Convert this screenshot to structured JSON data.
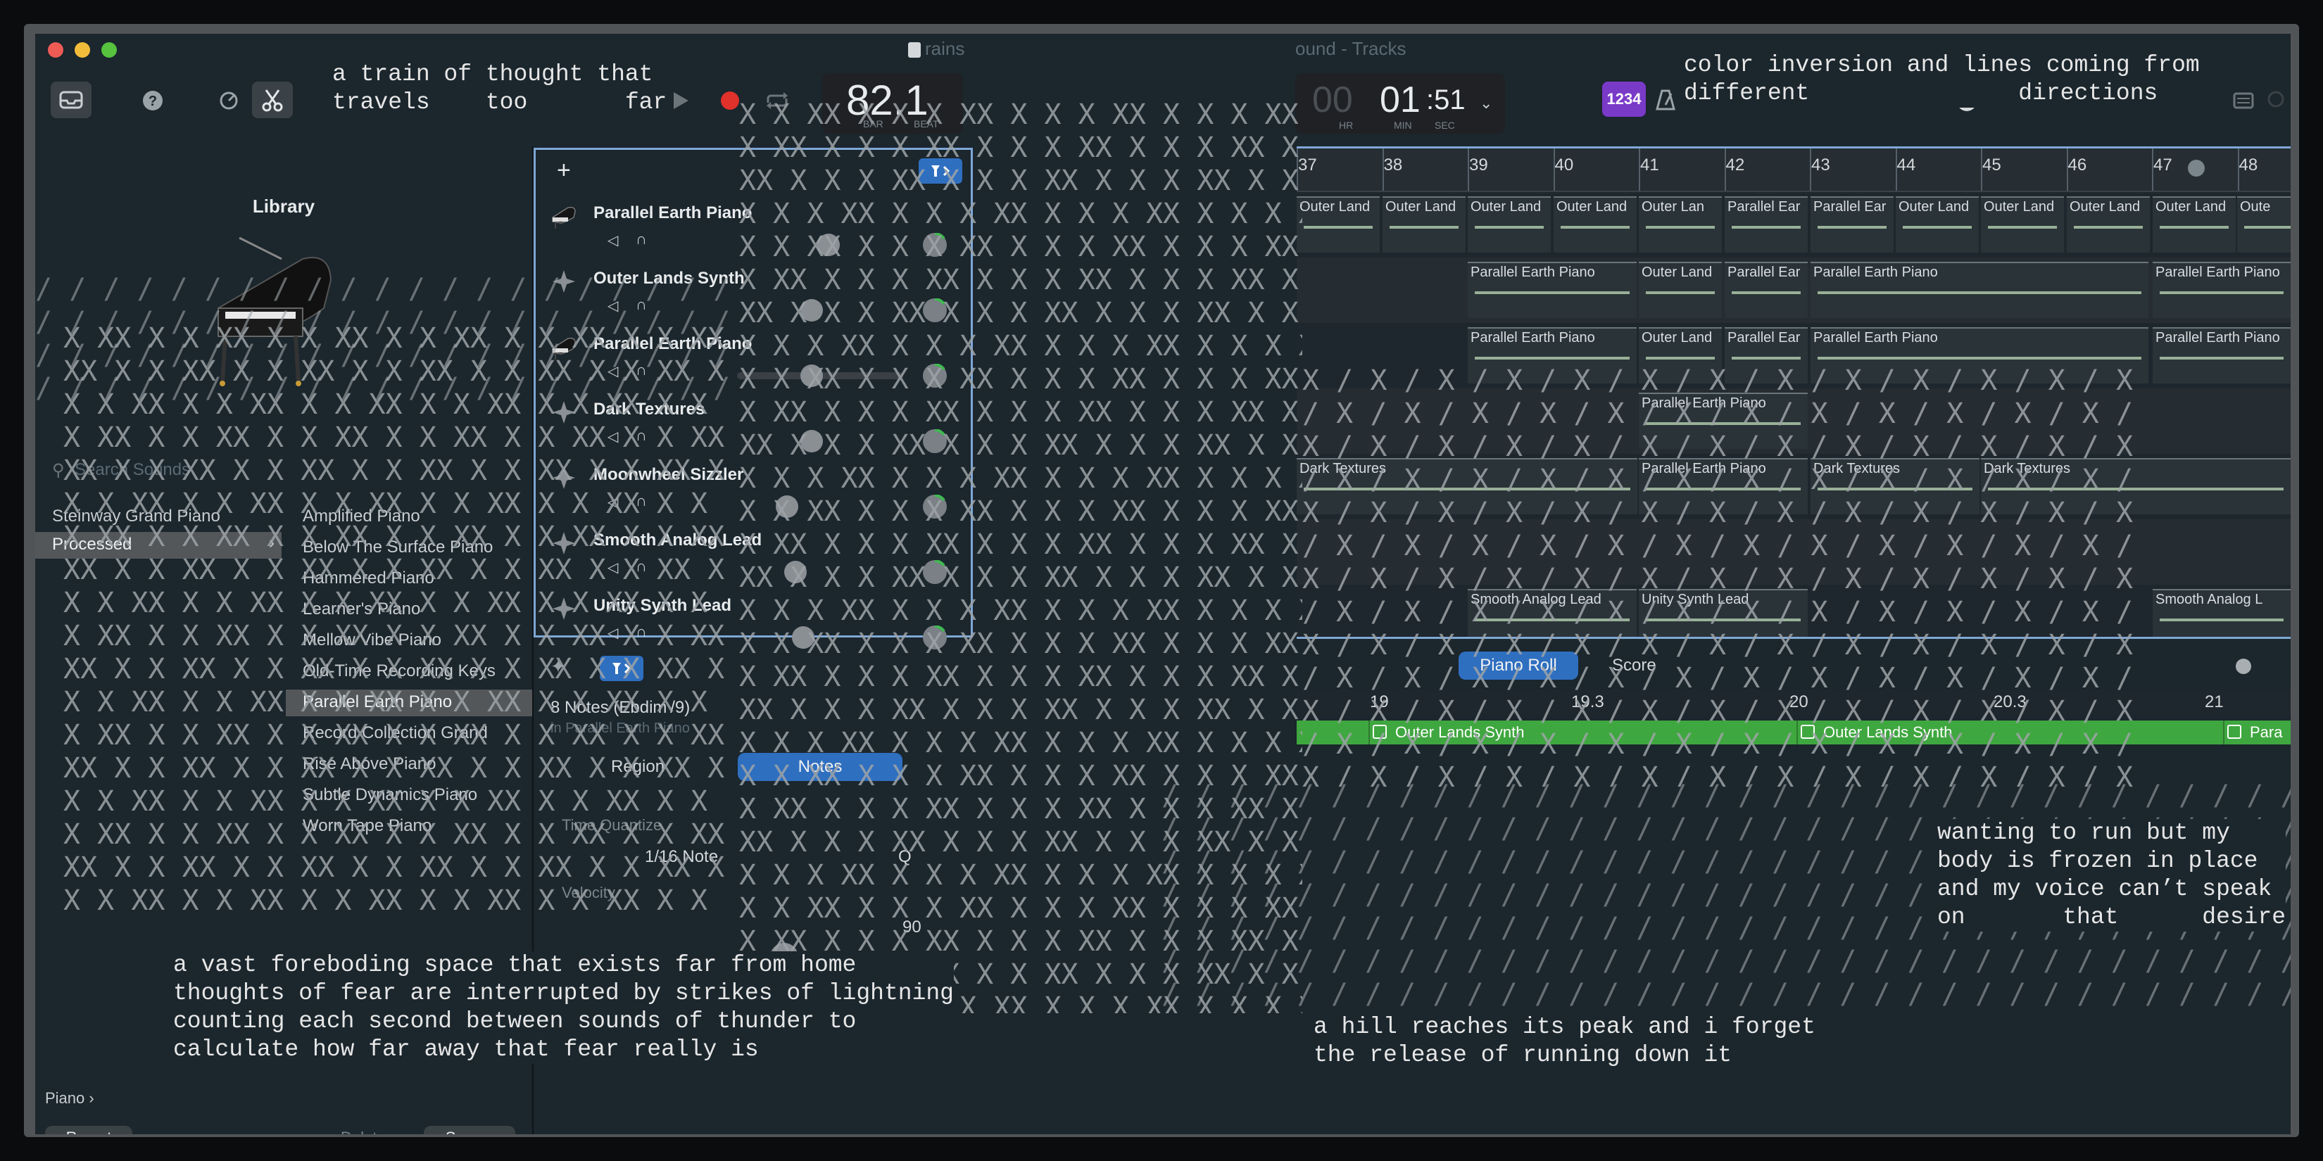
{
  "window": {
    "title_left": "rains",
    "title_right": "ound - Tracks"
  },
  "toolbar": {
    "lcd_position": "82.1",
    "lcd_position_sub_bar": "BAR",
    "lcd_position_sub_beat": "BEAT",
    "lcd_time_hr": "00",
    "lcd_time_min": "01",
    "lcd_time_sec": ":51",
    "lcd_time_sub_hr": "HR",
    "lcd_time_sub_min": "MIN",
    "lcd_time_sub_sec": "SEC",
    "count_in": "1234",
    "master_volume": 0.55,
    "accent": "#4a8ad8",
    "record_color": "#e0312b"
  },
  "poems": {
    "top_left": "a train of thought that\ntravels    too       far",
    "top_right": "color inversion and lines coming from\ndifferent               directions",
    "bottom_left": "a vast foreboding space that exists far from home\nthoughts of fear are interrupted by strikes of lightning\ncounting each second between sounds of thunder to\ncalculate how far away that fear really is",
    "bottom_middle": "a hill reaches its peak and i forget\nthe release of running down it",
    "bottom_right": "wanting to run but my\nbody is frozen in place\nand my voice can’t speak\non       that      desire"
  },
  "library": {
    "title": "Library",
    "search_placeholder": "Search Sounds",
    "categories": [
      "Steinway Grand Piano",
      "Processed"
    ],
    "selected_category": "Processed",
    "patches": [
      "Amplified Piano",
      "Below The Surface Piano",
      "Hammered Piano",
      "Learner's Piano",
      "Mellow Vibe Piano",
      "Old-Time Recording Keys",
      "Parallel Earth Piano",
      "Record Collection Grand",
      "Rise Above Piano",
      "Subtle Dynamics Piano",
      "Worn Tape Piano"
    ],
    "selected_patch": "Parallel Earth Piano",
    "footer_path": "Piano",
    "revert_label": "Revert",
    "delete_label": "Delete",
    "save_label": "Save..."
  },
  "tracks": {
    "add_label": "+",
    "list": [
      {
        "name": "Parallel Earth Piano",
        "volume": 0.55,
        "icon": "grand-piano-icon"
      },
      {
        "name": "Outer Lands Synth",
        "volume": 0.45,
        "icon": "synth-icon"
      },
      {
        "name": "Parallel Earth Piano",
        "volume": 0.45,
        "icon": "grand-piano-icon"
      },
      {
        "name": "Dark Textures",
        "volume": 0.45,
        "icon": "synth-icon"
      },
      {
        "name": "Moonwheel Sizzler",
        "volume": 0.3,
        "icon": "synth-icon"
      },
      {
        "name": "Smooth Analog Lead",
        "volume": 0.35,
        "icon": "synth-icon"
      },
      {
        "name": "Unity Synth Lead",
        "volume": 0.4,
        "icon": "synth-icon"
      }
    ]
  },
  "ruler": {
    "bars": [
      "37",
      "38",
      "39",
      "40",
      "41",
      "42",
      "43",
      "44",
      "45",
      "46",
      "47",
      "48"
    ]
  },
  "regions": {
    "lane1": [
      "Outer Land",
      "Outer Land",
      "Outer Land",
      "Outer Land",
      "Outer Lan",
      "Parallel Ear",
      "Parallel Ear",
      "Outer Land",
      "Outer Land",
      "Outer Land",
      "Outer Land",
      "Oute"
    ],
    "lane2": [
      "Parallel Earth Piano",
      "Outer Land",
      "Parallel Ear",
      "Parallel Earth Piano",
      "Parallel Earth Piano"
    ],
    "lane3": [
      "Parallel Earth Piano",
      "Outer Land",
      "Parallel Ear",
      "Parallel Earth Piano",
      "Parallel Earth Piano"
    ],
    "lane4": [
      "Parallel Earth Piano"
    ],
    "lane5": [
      "Dark Textures",
      "Parallel Earth Piano",
      "Dark Textures",
      "Dark Textures"
    ],
    "lane7": [
      "Smooth Analog Lead",
      "Unity Synth Lead",
      "Smooth Analog L"
    ]
  },
  "inspector": {
    "selection_title": "8 Notes (Ebdim /9)",
    "selection_sub": "in Parallel Earth Piano",
    "tab_region": "Region",
    "tab_notes": "Notes",
    "time_quantize_label": "Time Quantize",
    "time_quantize_value": "1/16 Note",
    "quantize_button": "Q",
    "velocity_label": "Velocity",
    "velocity_value": "90"
  },
  "editor": {
    "tab_piano_roll": "Piano Roll",
    "tab_score": "Score",
    "ruler": [
      "19",
      "19.3",
      "20",
      "20.3",
      "21"
    ],
    "regions": [
      "Outer Lands Synth",
      "Outer Lands Synth",
      "Para"
    ],
    "region_color": "#3fa73f"
  }
}
